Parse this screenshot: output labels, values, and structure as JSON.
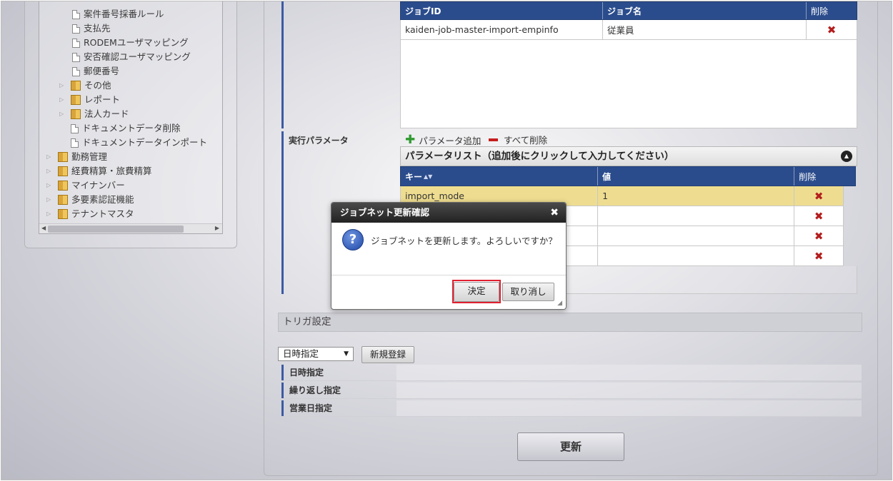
{
  "tree": {
    "items": [
      {
        "label": "案件番号採番ルール",
        "type": "doc",
        "indent": 3
      },
      {
        "label": "支払先",
        "type": "doc",
        "indent": 3
      },
      {
        "label": "RODEMユーザマッピング",
        "type": "doc",
        "indent": 3
      },
      {
        "label": "安否確認ユーザマッピング",
        "type": "doc",
        "indent": 3
      },
      {
        "label": "郵便番号",
        "type": "doc",
        "indent": 3
      },
      {
        "label": "その他",
        "type": "folder",
        "indent": 2
      },
      {
        "label": "レポート",
        "type": "folder",
        "indent": 2
      },
      {
        "label": "法人カード",
        "type": "folder",
        "indent": 2
      },
      {
        "label": "ドキュメントデータ削除",
        "type": "doc",
        "indent": 2
      },
      {
        "label": "ドキュメントデータインポート",
        "type": "doc",
        "indent": 2
      },
      {
        "label": "勤務管理",
        "type": "folder",
        "indent": 1
      },
      {
        "label": "経費精算・旅費精算",
        "type": "folder",
        "indent": 1
      },
      {
        "label": "マイナンバー",
        "type": "folder",
        "indent": 1
      },
      {
        "label": "多要素認証機能",
        "type": "folder",
        "indent": 1
      },
      {
        "label": "テナントマスタ",
        "type": "folder",
        "indent": 1
      }
    ]
  },
  "jobs": {
    "headers": {
      "id": "ジョブID",
      "name": "ジョブ名",
      "delete": "削除"
    },
    "rows": [
      {
        "id": "kaiden-job-master-import-empinfo",
        "name": "従業員"
      }
    ]
  },
  "params": {
    "section_label": "実行パラメータ",
    "add_label": "パラメータ追加",
    "delete_all_label": "すべて削除",
    "list_title": "パラメータリスト（追加後にクリックして入力してください）",
    "headers": {
      "key": "キー",
      "value": "値",
      "delete": "削除"
    },
    "rows": [
      {
        "key": "import_mode",
        "value": "1"
      },
      {
        "key": "",
        "value": ""
      },
      {
        "key": "",
        "value": ""
      },
      {
        "key": "",
        "value": ""
      }
    ]
  },
  "trigger": {
    "title": "トリガ設定",
    "select_value": "日時指定",
    "new_button": "新規登録",
    "rows": [
      "日時指定",
      "繰り返し指定",
      "営業日指定"
    ]
  },
  "update_button": "更新",
  "dialog": {
    "title": "ジョブネット更新確認",
    "message": "ジョブネットを更新します。よろしいですか？",
    "ok": "決定",
    "cancel": "取り消し"
  },
  "colors": {
    "header_blue": "#2b4c8c",
    "highlight_row": "#eedd90",
    "delete_red": "#b41d1d",
    "focus_red": "#e02030"
  }
}
